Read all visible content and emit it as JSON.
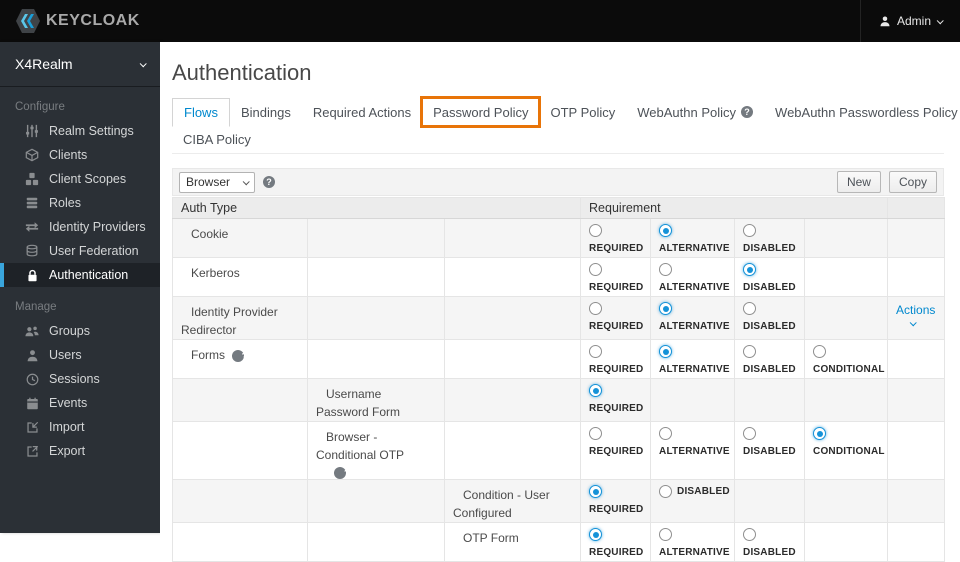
{
  "topbar": {
    "brand": "KEYCLOAK",
    "user_label": "Admin"
  },
  "sidebar": {
    "realm": "X4Realm",
    "configure": {
      "label": "Configure",
      "items": [
        {
          "label": "Realm Settings",
          "icon": "sliders-icon"
        },
        {
          "label": "Clients",
          "icon": "cube-icon"
        },
        {
          "label": "Client Scopes",
          "icon": "cubes-icon"
        },
        {
          "label": "Roles",
          "icon": "layers-icon"
        },
        {
          "label": "Identity Providers",
          "icon": "exchange-icon"
        },
        {
          "label": "User Federation",
          "icon": "database-icon"
        },
        {
          "label": "Authentication",
          "icon": "lock-icon",
          "active": true
        }
      ]
    },
    "manage": {
      "label": "Manage",
      "items": [
        {
          "label": "Groups",
          "icon": "groups-icon"
        },
        {
          "label": "Users",
          "icon": "user-icon"
        },
        {
          "label": "Sessions",
          "icon": "clock-icon"
        },
        {
          "label": "Events",
          "icon": "calendar-icon"
        },
        {
          "label": "Import",
          "icon": "import-icon"
        },
        {
          "label": "Export",
          "icon": "export-icon"
        }
      ]
    }
  },
  "page": {
    "title": "Authentication"
  },
  "tabs": {
    "row1": [
      {
        "label": "Flows",
        "active": true
      },
      {
        "label": "Bindings"
      },
      {
        "label": "Required Actions"
      },
      {
        "label": "Password Policy",
        "highlighted": true
      },
      {
        "label": "OTP Policy"
      },
      {
        "label": "WebAuthn Policy",
        "help": true
      },
      {
        "label": "WebAuthn Passwordless Policy",
        "help": true
      }
    ],
    "row2": [
      {
        "label": "CIBA Policy"
      }
    ]
  },
  "toolbar": {
    "flow_selected": "Browser",
    "new_label": "New",
    "copy_label": "Copy"
  },
  "table": {
    "headers": {
      "auth_type": "Auth Type",
      "requirement": "Requirement"
    },
    "actions_label": "Actions",
    "rows": [
      {
        "name": "Cookie",
        "options": [
          {
            "label": "REQUIRED",
            "checked": false
          },
          {
            "label": "ALTERNATIVE",
            "checked": true
          },
          {
            "label": "DISABLED",
            "checked": false
          }
        ]
      },
      {
        "name": "Kerberos",
        "options": [
          {
            "label": "REQUIRED",
            "checked": false
          },
          {
            "label": "ALTERNATIVE",
            "checked": false
          },
          {
            "label": "DISABLED",
            "checked": true
          }
        ]
      },
      {
        "name": "Identity Provider Redirector",
        "has_actions": true,
        "options": [
          {
            "label": "REQUIRED",
            "checked": false
          },
          {
            "label": "ALTERNATIVE",
            "checked": true
          },
          {
            "label": "DISABLED",
            "checked": false
          }
        ]
      },
      {
        "name": "Forms",
        "help": true,
        "options": [
          {
            "label": "REQUIRED",
            "checked": false
          },
          {
            "label": "ALTERNATIVE",
            "checked": true
          },
          {
            "label": "DISABLED",
            "checked": false
          },
          {
            "label": "CONDITIONAL",
            "checked": false
          }
        ]
      },
      {
        "name": "Username Password Form",
        "options": [
          {
            "label": "REQUIRED",
            "checked": true
          }
        ]
      },
      {
        "name": "Browser - Conditional OTP",
        "help": true,
        "options": [
          {
            "label": "REQUIRED",
            "checked": false
          },
          {
            "label": "ALTERNATIVE",
            "checked": false
          },
          {
            "label": "DISABLED",
            "checked": false
          },
          {
            "label": "CONDITIONAL",
            "checked": true
          }
        ]
      },
      {
        "name": "Condition - User Configured",
        "options": [
          {
            "label": "REQUIRED",
            "checked": true
          },
          {
            "label": "DISABLED",
            "checked": false,
            "inline": true
          }
        ]
      },
      {
        "name": "OTP Form",
        "options": [
          {
            "label": "REQUIRED",
            "checked": true
          },
          {
            "label": "ALTERNATIVE",
            "checked": false
          },
          {
            "label": "DISABLED",
            "checked": false
          }
        ]
      }
    ]
  },
  "colors": {
    "accent_blue": "#0088ce",
    "highlight_orange": "#e87408",
    "radio_blue": "#1592d8",
    "active_nav_border": "#39a5dc"
  }
}
